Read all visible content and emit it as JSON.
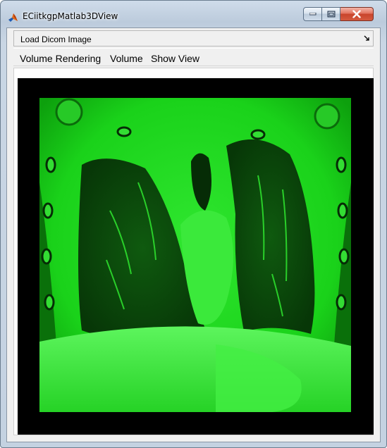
{
  "window": {
    "title": "ECiitkgpMatlab3DView",
    "icon": "matlab-icon",
    "controls": [
      "minimize-icon",
      "maximize-icon",
      "close-icon"
    ]
  },
  "toolbar": {
    "label": "Load Dicom Image",
    "arrow_icon": "panel-arrow-icon"
  },
  "menu": {
    "items": [
      {
        "label": "Volume Rendering"
      },
      {
        "label": "Volume"
      },
      {
        "label": "Show View"
      }
    ]
  },
  "viewer": {
    "image": "green-tinted coronal chest CT slice",
    "tint_color": "#1ee81e",
    "background_color": "#000000"
  }
}
